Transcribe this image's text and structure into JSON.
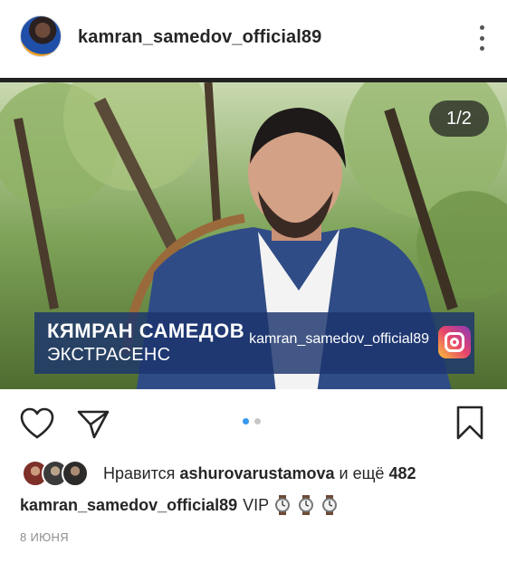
{
  "post": {
    "username": "kamran_samedov_official89",
    "date": "8 ИЮНЯ"
  },
  "media": {
    "counter": "1/2",
    "overlay_name": "КЯМРАН САМЕДОВ",
    "overlay_role": "ЭКСТРАСЕНС",
    "overlay_handle": "kamran_samedov_official89",
    "carousel_active_index": 0,
    "carousel_count": 2
  },
  "likes": {
    "prefix": "Нравится",
    "user": "ashurovarustamova",
    "middle": "и ещё",
    "count": "482"
  },
  "caption": {
    "author": "kamran_samedov_official89",
    "text": "VIP",
    "emoji_icons": [
      "watch-icon",
      "watch-icon",
      "watch-icon"
    ]
  },
  "colors": {
    "accent": "#3897f0",
    "overlay_bg": "#1c346e"
  }
}
